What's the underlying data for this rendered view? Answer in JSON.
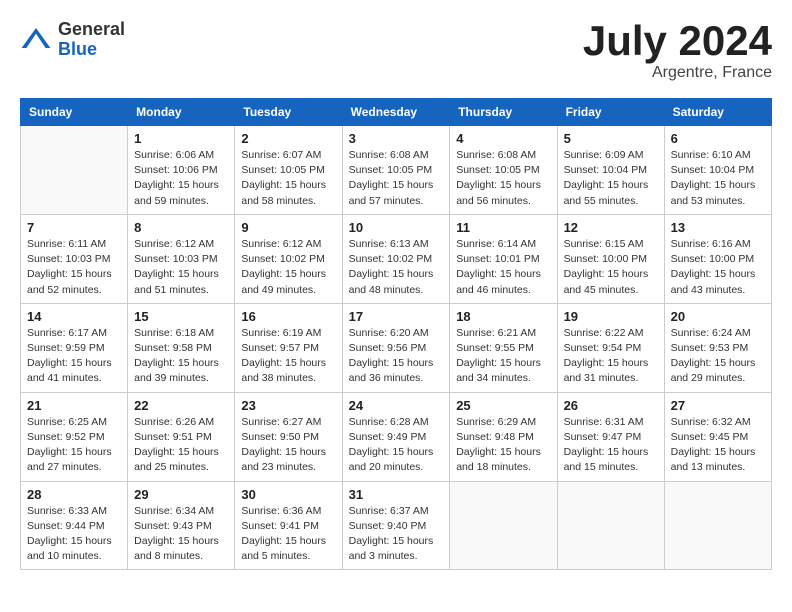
{
  "logo": {
    "general": "General",
    "blue": "Blue"
  },
  "title": {
    "month_year": "July 2024",
    "location": "Argentre, France"
  },
  "days_of_week": [
    "Sunday",
    "Monday",
    "Tuesday",
    "Wednesday",
    "Thursday",
    "Friday",
    "Saturday"
  ],
  "weeks": [
    [
      {
        "day": "",
        "info": ""
      },
      {
        "day": "1",
        "info": "Sunrise: 6:06 AM\nSunset: 10:06 PM\nDaylight: 15 hours\nand 59 minutes."
      },
      {
        "day": "2",
        "info": "Sunrise: 6:07 AM\nSunset: 10:05 PM\nDaylight: 15 hours\nand 58 minutes."
      },
      {
        "day": "3",
        "info": "Sunrise: 6:08 AM\nSunset: 10:05 PM\nDaylight: 15 hours\nand 57 minutes."
      },
      {
        "day": "4",
        "info": "Sunrise: 6:08 AM\nSunset: 10:05 PM\nDaylight: 15 hours\nand 56 minutes."
      },
      {
        "day": "5",
        "info": "Sunrise: 6:09 AM\nSunset: 10:04 PM\nDaylight: 15 hours\nand 55 minutes."
      },
      {
        "day": "6",
        "info": "Sunrise: 6:10 AM\nSunset: 10:04 PM\nDaylight: 15 hours\nand 53 minutes."
      }
    ],
    [
      {
        "day": "7",
        "info": "Sunrise: 6:11 AM\nSunset: 10:03 PM\nDaylight: 15 hours\nand 52 minutes."
      },
      {
        "day": "8",
        "info": "Sunrise: 6:12 AM\nSunset: 10:03 PM\nDaylight: 15 hours\nand 51 minutes."
      },
      {
        "day": "9",
        "info": "Sunrise: 6:12 AM\nSunset: 10:02 PM\nDaylight: 15 hours\nand 49 minutes."
      },
      {
        "day": "10",
        "info": "Sunrise: 6:13 AM\nSunset: 10:02 PM\nDaylight: 15 hours\nand 48 minutes."
      },
      {
        "day": "11",
        "info": "Sunrise: 6:14 AM\nSunset: 10:01 PM\nDaylight: 15 hours\nand 46 minutes."
      },
      {
        "day": "12",
        "info": "Sunrise: 6:15 AM\nSunset: 10:00 PM\nDaylight: 15 hours\nand 45 minutes."
      },
      {
        "day": "13",
        "info": "Sunrise: 6:16 AM\nSunset: 10:00 PM\nDaylight: 15 hours\nand 43 minutes."
      }
    ],
    [
      {
        "day": "14",
        "info": "Sunrise: 6:17 AM\nSunset: 9:59 PM\nDaylight: 15 hours\nand 41 minutes."
      },
      {
        "day": "15",
        "info": "Sunrise: 6:18 AM\nSunset: 9:58 PM\nDaylight: 15 hours\nand 39 minutes."
      },
      {
        "day": "16",
        "info": "Sunrise: 6:19 AM\nSunset: 9:57 PM\nDaylight: 15 hours\nand 38 minutes."
      },
      {
        "day": "17",
        "info": "Sunrise: 6:20 AM\nSunset: 9:56 PM\nDaylight: 15 hours\nand 36 minutes."
      },
      {
        "day": "18",
        "info": "Sunrise: 6:21 AM\nSunset: 9:55 PM\nDaylight: 15 hours\nand 34 minutes."
      },
      {
        "day": "19",
        "info": "Sunrise: 6:22 AM\nSunset: 9:54 PM\nDaylight: 15 hours\nand 31 minutes."
      },
      {
        "day": "20",
        "info": "Sunrise: 6:24 AM\nSunset: 9:53 PM\nDaylight: 15 hours\nand 29 minutes."
      }
    ],
    [
      {
        "day": "21",
        "info": "Sunrise: 6:25 AM\nSunset: 9:52 PM\nDaylight: 15 hours\nand 27 minutes."
      },
      {
        "day": "22",
        "info": "Sunrise: 6:26 AM\nSunset: 9:51 PM\nDaylight: 15 hours\nand 25 minutes."
      },
      {
        "day": "23",
        "info": "Sunrise: 6:27 AM\nSunset: 9:50 PM\nDaylight: 15 hours\nand 23 minutes."
      },
      {
        "day": "24",
        "info": "Sunrise: 6:28 AM\nSunset: 9:49 PM\nDaylight: 15 hours\nand 20 minutes."
      },
      {
        "day": "25",
        "info": "Sunrise: 6:29 AM\nSunset: 9:48 PM\nDaylight: 15 hours\nand 18 minutes."
      },
      {
        "day": "26",
        "info": "Sunrise: 6:31 AM\nSunset: 9:47 PM\nDaylight: 15 hours\nand 15 minutes."
      },
      {
        "day": "27",
        "info": "Sunrise: 6:32 AM\nSunset: 9:45 PM\nDaylight: 15 hours\nand 13 minutes."
      }
    ],
    [
      {
        "day": "28",
        "info": "Sunrise: 6:33 AM\nSunset: 9:44 PM\nDaylight: 15 hours\nand 10 minutes."
      },
      {
        "day": "29",
        "info": "Sunrise: 6:34 AM\nSunset: 9:43 PM\nDaylight: 15 hours\nand 8 minutes."
      },
      {
        "day": "30",
        "info": "Sunrise: 6:36 AM\nSunset: 9:41 PM\nDaylight: 15 hours\nand 5 minutes."
      },
      {
        "day": "31",
        "info": "Sunrise: 6:37 AM\nSunset: 9:40 PM\nDaylight: 15 hours\nand 3 minutes."
      },
      {
        "day": "",
        "info": ""
      },
      {
        "day": "",
        "info": ""
      },
      {
        "day": "",
        "info": ""
      }
    ]
  ]
}
